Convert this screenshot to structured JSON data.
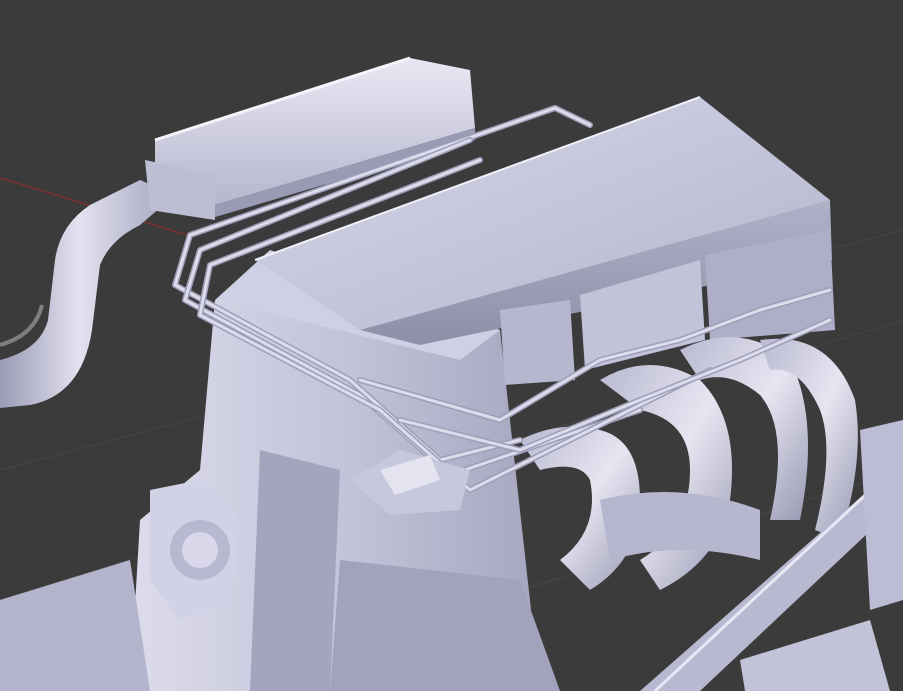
{
  "viewport": {
    "kind": "3d-viewport",
    "background_color": "#3b3b3b",
    "grid_color": "#4a4a4a",
    "x_axis_color": "#8a3333",
    "model_color": "#c9c9e0",
    "model_shadow_color": "#9c9cb6",
    "model_highlight_color": "#ececf6"
  }
}
